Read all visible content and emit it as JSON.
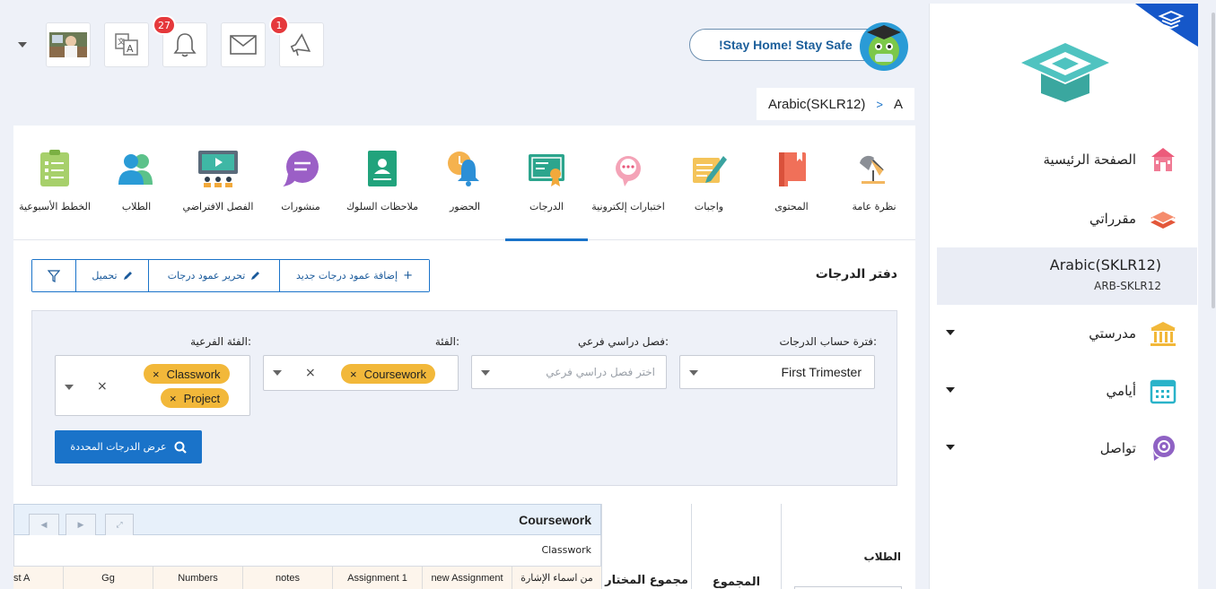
{
  "header": {
    "stay_home": "!Stay Home! Stay Safe",
    "notification_count": "27",
    "announcement_count": "1",
    "breadcrumb": {
      "course": "Arabic(SKLR12)",
      "separator": ">",
      "section": "A"
    }
  },
  "sidebar": {
    "items": [
      {
        "label": "الصفحة الرئيسية",
        "icon": "home-icon"
      },
      {
        "label": "مقرراتي",
        "icon": "books-icon"
      },
      {
        "label": "مدرستي",
        "icon": "school-icon"
      },
      {
        "label": "أيامي",
        "icon": "calendar-icon"
      },
      {
        "label": "تواصل",
        "icon": "chat-icon"
      }
    ],
    "active_course": {
      "name": "Arabic(SKLR12)",
      "code": "ARB-SKLR12"
    }
  },
  "tabs": [
    {
      "label": "نظرة عامة",
      "icon": "overview-lamp-icon"
    },
    {
      "label": "المحتوى",
      "icon": "content-book-icon"
    },
    {
      "label": "واجبات",
      "icon": "assignments-icon"
    },
    {
      "label": "اختبارات إلكترونية",
      "icon": "e-tests-icon"
    },
    {
      "label": "الدرجات",
      "icon": "grades-certificate-icon"
    },
    {
      "label": "الحضور",
      "icon": "attendance-bell-icon"
    },
    {
      "label": "ملاحظات السلوك",
      "icon": "behavior-notes-icon"
    },
    {
      "label": "منشورات",
      "icon": "posts-icon"
    },
    {
      "label": "الفصل الافتراضي",
      "icon": "virtual-class-icon"
    },
    {
      "label": "الطلاب",
      "icon": "students-icon"
    },
    {
      "label": "الخطط الأسبوعية",
      "icon": "weekly-plans-icon"
    }
  ],
  "gradebook": {
    "title": "دفتر الدرجات",
    "toolbar": {
      "add_column": "إضافة عمود درجات جديد",
      "edit_column": "تحرير عمود درجات",
      "download": "تحميل"
    },
    "filters": {
      "period_label": "فترة حساب الدرجات:",
      "period_value": "First Trimester",
      "sub_term_label": "فصل دراسي فرعي:",
      "sub_term_placeholder": "اختر فصل دراسي فرعي",
      "category_label": "الفئة:",
      "category_chips": [
        "Coursework"
      ],
      "subcategory_label": "الفئة الفرعية:",
      "subcategory_chips": [
        "Classwork",
        "Project"
      ],
      "view_button": "عرض الدرجات المحددة"
    },
    "table": {
      "category_header": "Coursework",
      "subcategory_header": "Classwork",
      "columns": [
        "st A",
        "Gg",
        "Numbers",
        "notes",
        "Assignment 1",
        "new Assignment",
        "من اسماء الإشارة"
      ],
      "selected_total": "مجموع المختار",
      "total": "المجموع",
      "students": "الطلاب"
    }
  }
}
